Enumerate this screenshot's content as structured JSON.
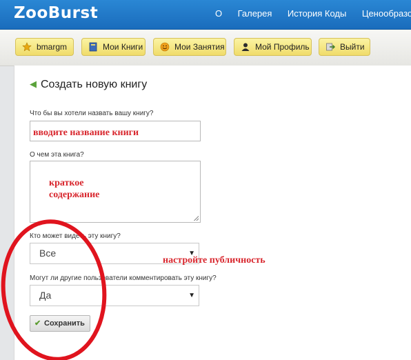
{
  "header": {
    "logo": "ZooBurst",
    "nav": [
      "О",
      "Галерея",
      "История Коды",
      "Ценообразова"
    ]
  },
  "toolbar": {
    "user_label": "bmargm",
    "books_label": "Мои Книги",
    "classes_label": "Мои Занятия",
    "profile_label": "Мой Профиль",
    "logout_label": "Выйти"
  },
  "form": {
    "title": "Создать новую книгу",
    "name_question": "Что бы вы хотели назвать вашу книгу?",
    "about_question": "О чем эта книга?",
    "visibility_question": "Кто может видеть эту книгу?",
    "visibility_value": "Все",
    "comments_question": "Могут ли другие пользователи комментировать эту книгу?",
    "comments_value": "Да",
    "save_label": "Сохранить"
  },
  "annotations": {
    "name_hint": "вводите название книги",
    "summary_hint_line1": "краткое",
    "summary_hint_line2": "содержание",
    "public_hint": "настройте публичность"
  },
  "colors": {
    "header_blue": "#1a6cbc",
    "annotation_red": "#d8262d",
    "toolbar_button_yellow": "#f0dc6a"
  }
}
